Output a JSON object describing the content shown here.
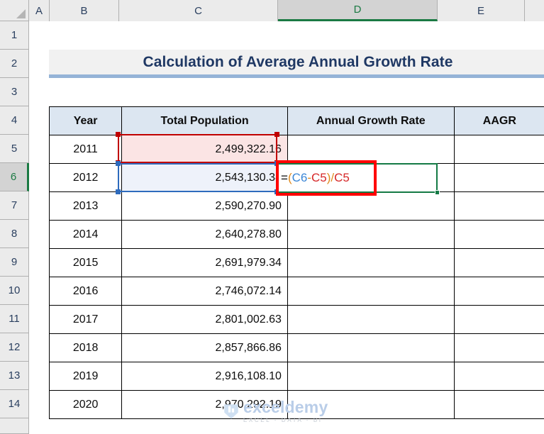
{
  "spreadsheet": {
    "column_headers": [
      "A",
      "B",
      "C",
      "D",
      "E"
    ],
    "active_column": "D",
    "row_headers": [
      "1",
      "2",
      "3",
      "4",
      "5",
      "6",
      "7",
      "8",
      "9",
      "10",
      "11",
      "12",
      "13",
      "14"
    ],
    "active_row": "6",
    "active_cell": "D6",
    "corner_icon": "select-all-triangle-icon"
  },
  "title": {
    "text": "Calculation of Average Annual Growth Rate"
  },
  "table": {
    "headers": [
      "Year",
      "Total Population",
      "Annual Growth Rate",
      "AAGR"
    ],
    "rows": [
      {
        "year": "2011",
        "population": "2,499,322.16",
        "growth": "",
        "aagr": ""
      },
      {
        "year": "2012",
        "population": "2,543,130.38",
        "growth": "",
        "aagr": ""
      },
      {
        "year": "2013",
        "population": "2,590,270.90",
        "growth": "",
        "aagr": ""
      },
      {
        "year": "2014",
        "population": "2,640,278.80",
        "growth": "",
        "aagr": ""
      },
      {
        "year": "2015",
        "population": "2,691,979.34",
        "growth": "",
        "aagr": ""
      },
      {
        "year": "2016",
        "population": "2,746,072.14",
        "growth": "",
        "aagr": ""
      },
      {
        "year": "2017",
        "population": "2,801,002.63",
        "growth": "",
        "aagr": ""
      },
      {
        "year": "2018",
        "population": "2,857,866.86",
        "growth": "",
        "aagr": ""
      },
      {
        "year": "2019",
        "population": "2,916,108.10",
        "growth": "",
        "aagr": ""
      },
      {
        "year": "2020",
        "population": "2,970,292.19",
        "growth": "",
        "aagr": ""
      }
    ]
  },
  "formula": {
    "full_text": "=(C6-C5)/C5",
    "tokens": {
      "equals": "=",
      "open_paren": "(",
      "ref_blue": "C6",
      "minus": "-",
      "ref_red_1": "C5",
      "close_paren": ")",
      "divide": "/",
      "ref_red_2": "C5"
    }
  },
  "watermark": {
    "name": "exceldemy",
    "tagline": "EXCEL - DATA - BI",
    "logo": "exceldemy-logo-icon"
  },
  "colors": {
    "selection_green": "#147a45",
    "ref_red": "#c00000",
    "ref_blue": "#2e6bbd",
    "annotation_red": "#ff0000",
    "header_fill": "#dce6f1",
    "title_underline": "#95b3d7",
    "title_text": "#1f3864"
  }
}
